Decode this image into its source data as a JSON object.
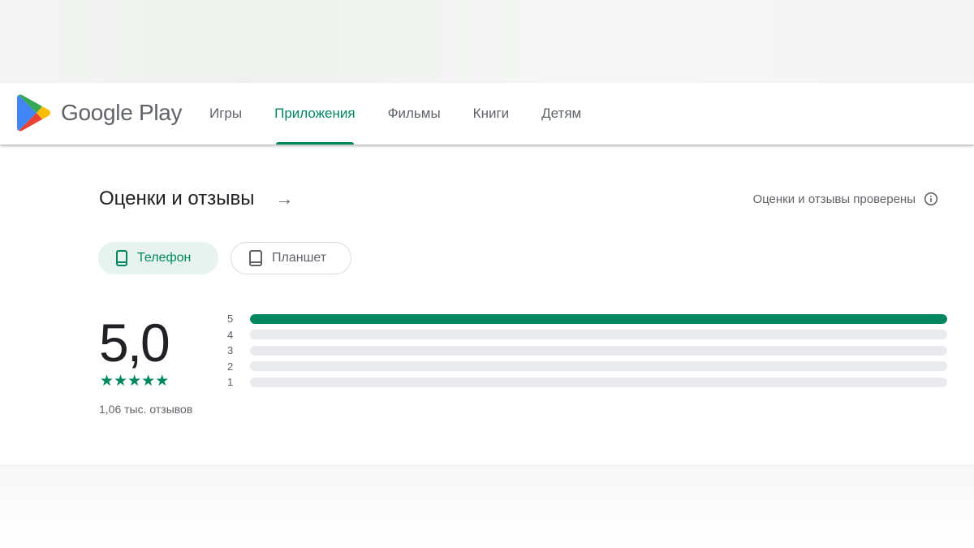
{
  "brand": {
    "name": "Google Play"
  },
  "nav": {
    "tabs": [
      {
        "label": "Игры"
      },
      {
        "label": "Приложения",
        "active": true
      },
      {
        "label": "Фильмы"
      },
      {
        "label": "Книги"
      },
      {
        "label": "Детям"
      }
    ]
  },
  "section": {
    "title": "Оценки и отзывы",
    "verified": "Оценки и отзывы проверены"
  },
  "devices": {
    "phone": "Телефон",
    "tablet": "Планшет",
    "selected": "phone"
  },
  "rating": {
    "score": "5,0",
    "stars": 5,
    "count": "1,06 тыс. отзывов",
    "distribution": [
      {
        "label": "5",
        "fraction": 1.0
      },
      {
        "label": "4",
        "fraction": 0
      },
      {
        "label": "3",
        "fraction": 0
      },
      {
        "label": "2",
        "fraction": 0
      },
      {
        "label": "1",
        "fraction": 0
      }
    ]
  },
  "colors": {
    "accent": "#01875f",
    "track": "#e8eaed"
  }
}
